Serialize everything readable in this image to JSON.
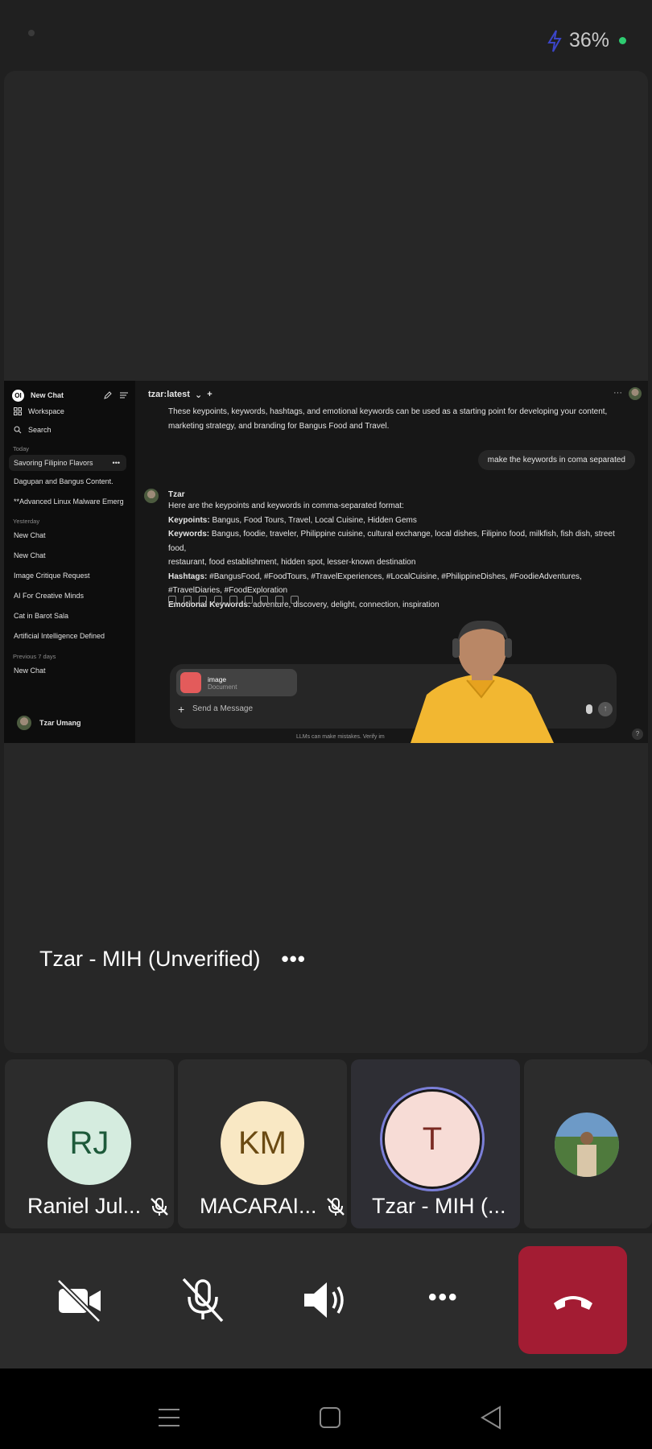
{
  "status_bar": {
    "battery_percent": "36%"
  },
  "shared_screen": {
    "sidebar": {
      "new_chat": "New Chat",
      "workspace": "Workspace",
      "search": "Search",
      "sections": [
        {
          "label": "Today",
          "items": [
            "Savoring Filipino Flavors",
            "Dagupan and Bangus Content.",
            "**Advanced Linux Malware Emerg"
          ]
        },
        {
          "label": "Yesterday",
          "items": [
            "New Chat",
            "New Chat",
            "Image Critique Request",
            "AI For Creative Minds",
            "Cat in Barot Sala",
            "Artificial Intelligence Defined"
          ]
        },
        {
          "label": "Previous 7 days",
          "items": [
            "New Chat"
          ]
        }
      ],
      "user_name": "Tzar Umang"
    },
    "chat": {
      "model_name": "tzar:latest",
      "intro_line1": "These keypoints, keywords, hashtags, and emotional keywords can be used as a starting point for developing your content,",
      "intro_line2": "marketing strategy, and branding for Bangus Food and Travel.",
      "user_message": "make the keywords in coma separated",
      "bot_name": "Tzar",
      "bot_intro": "Here are the keypoints and keywords in comma-separated format:",
      "keypoints_label": "Keypoints:",
      "keypoints": "Bangus, Food Tours, Travel, Local Cuisine, Hidden Gems",
      "keywords_label": "Keywords:",
      "keywords_line1": "Bangus, foodie, traveler, Philippine cuisine, cultural exchange, local dishes, Filipino food, milkfish, fish dish, street food,",
      "keywords_line2": "restaurant, food establishment, hidden spot, lesser-known destination",
      "hashtags_label": "Hashtags:",
      "hashtags_line1": "#BangusFood, #FoodTours, #TravelExperiences, #LocalCuisine, #PhilippineDishes, #FoodieAdventures,",
      "hashtags_line2": "#TravelDiaries, #FoodExploration",
      "emotional_label": "Emotional Keywords:",
      "emotional": "adventure, discovery, delight, connection, inspiration",
      "attachment_name": "image",
      "attachment_type": "Document",
      "input_placeholder": "Send a Message",
      "disclaimer": "LLMs can make mistakes. Verify im",
      "help": "?"
    }
  },
  "presenter": {
    "name": "Tzar - MIH (Unverified)",
    "more": "•••"
  },
  "participants": [
    {
      "initials": "RJ",
      "name": "Raniel Jul...",
      "muted": true,
      "avatar_bg": "#d5ecdf",
      "avatar_fg": "#1d5a3a"
    },
    {
      "initials": "KM",
      "name": "MACARAI...",
      "muted": true,
      "avatar_bg": "#f9e8c4",
      "avatar_fg": "#6b4a12"
    },
    {
      "initials": "T",
      "name": "Tzar - MIH (...",
      "muted": false,
      "speaking": true,
      "avatar_bg": "#f7dcd6",
      "avatar_fg": "#7a2a22"
    },
    {
      "initials": "",
      "name": "",
      "photo": true
    }
  ],
  "controls": {
    "camera": "video-off-icon",
    "mic": "mic-off-icon",
    "speaker": "speaker-icon",
    "more": "•••",
    "hangup": "hang-up-icon",
    "hangup_color": "#a31c33"
  },
  "nav": [
    "menu-icon",
    "home-icon",
    "back-icon"
  ]
}
